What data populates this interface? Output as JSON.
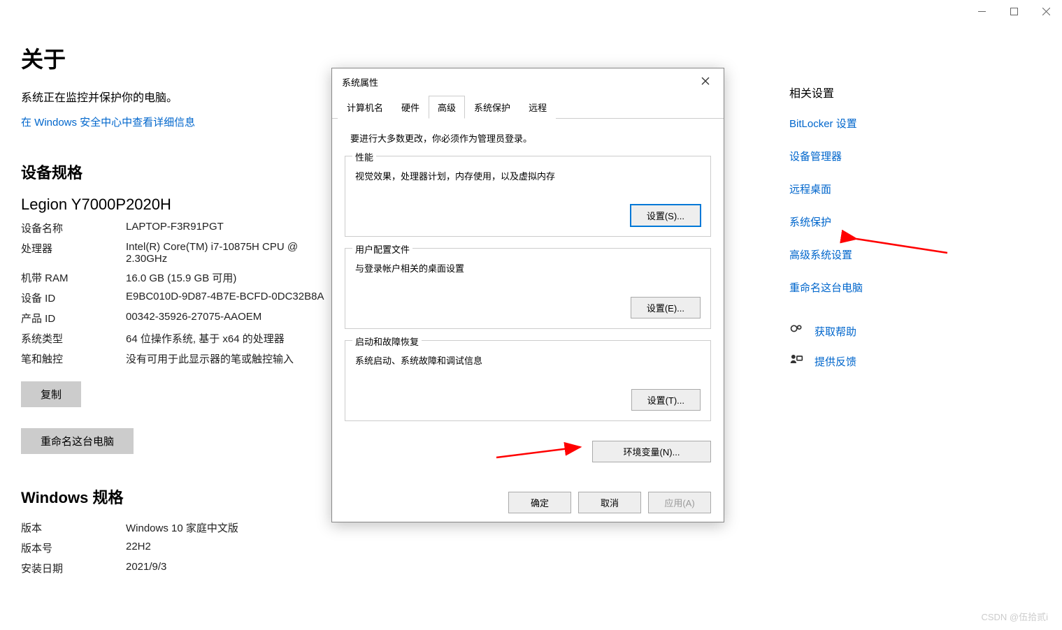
{
  "titlebar": {
    "min": "—",
    "max": "▢",
    "close": "✕"
  },
  "page": {
    "title": "关于",
    "subtitle": "系统正在监控并保护你的电脑。",
    "security_link": "在 Windows 安全中心中查看详细信息",
    "device_spec_title": "设备规格",
    "model": "Legion Y7000P2020H",
    "specs": [
      {
        "label": "设备名称",
        "value": "LAPTOP-F3R91PGT"
      },
      {
        "label": "处理器",
        "value": "Intel(R) Core(TM) i7-10875H CPU @ 2.30GHz"
      },
      {
        "label": "机带 RAM",
        "value": "16.0 GB (15.9 GB 可用)"
      },
      {
        "label": "设备 ID",
        "value": "E9BC010D-9D87-4B7E-BCFD-0DC32B8A"
      },
      {
        "label": "产品 ID",
        "value": "00342-35926-27075-AAOEM"
      },
      {
        "label": "系统类型",
        "value": "64 位操作系统, 基于 x64 的处理器"
      },
      {
        "label": "笔和触控",
        "value": "没有可用于此显示器的笔或触控输入"
      }
    ],
    "copy_btn": "复制",
    "rename_btn": "重命名这台电脑",
    "windows_spec_title": "Windows 规格",
    "win_specs": [
      {
        "label": "版本",
        "value": "Windows 10 家庭中文版"
      },
      {
        "label": "版本号",
        "value": "22H2"
      },
      {
        "label": "安装日期",
        "value": "2021/9/3"
      }
    ]
  },
  "sidebar": {
    "title": "相关设置",
    "links": [
      "BitLocker 设置",
      "设备管理器",
      "远程桌面",
      "系统保护",
      "高级系统设置",
      "重命名这台电脑"
    ],
    "help": "获取帮助",
    "feedback": "提供反馈"
  },
  "dialog": {
    "title": "系统属性",
    "tabs": [
      "计算机名",
      "硬件",
      "高级",
      "系统保护",
      "远程"
    ],
    "active_tab": 2,
    "admin_note": "要进行大多数更改，你必须作为管理员登录。",
    "groups": [
      {
        "title": "性能",
        "desc": "视觉效果，处理器计划，内存使用，以及虚拟内存",
        "btn": "设置(S)..."
      },
      {
        "title": "用户配置文件",
        "desc": "与登录帐户相关的桌面设置",
        "btn": "设置(E)..."
      },
      {
        "title": "启动和故障恢复",
        "desc": "系统启动、系统故障和调试信息",
        "btn": "设置(T)..."
      }
    ],
    "env_btn": "环境变量(N)...",
    "ok": "确定",
    "cancel": "取消",
    "apply": "应用(A)"
  },
  "watermark": "CSDN @伍拾贰i"
}
